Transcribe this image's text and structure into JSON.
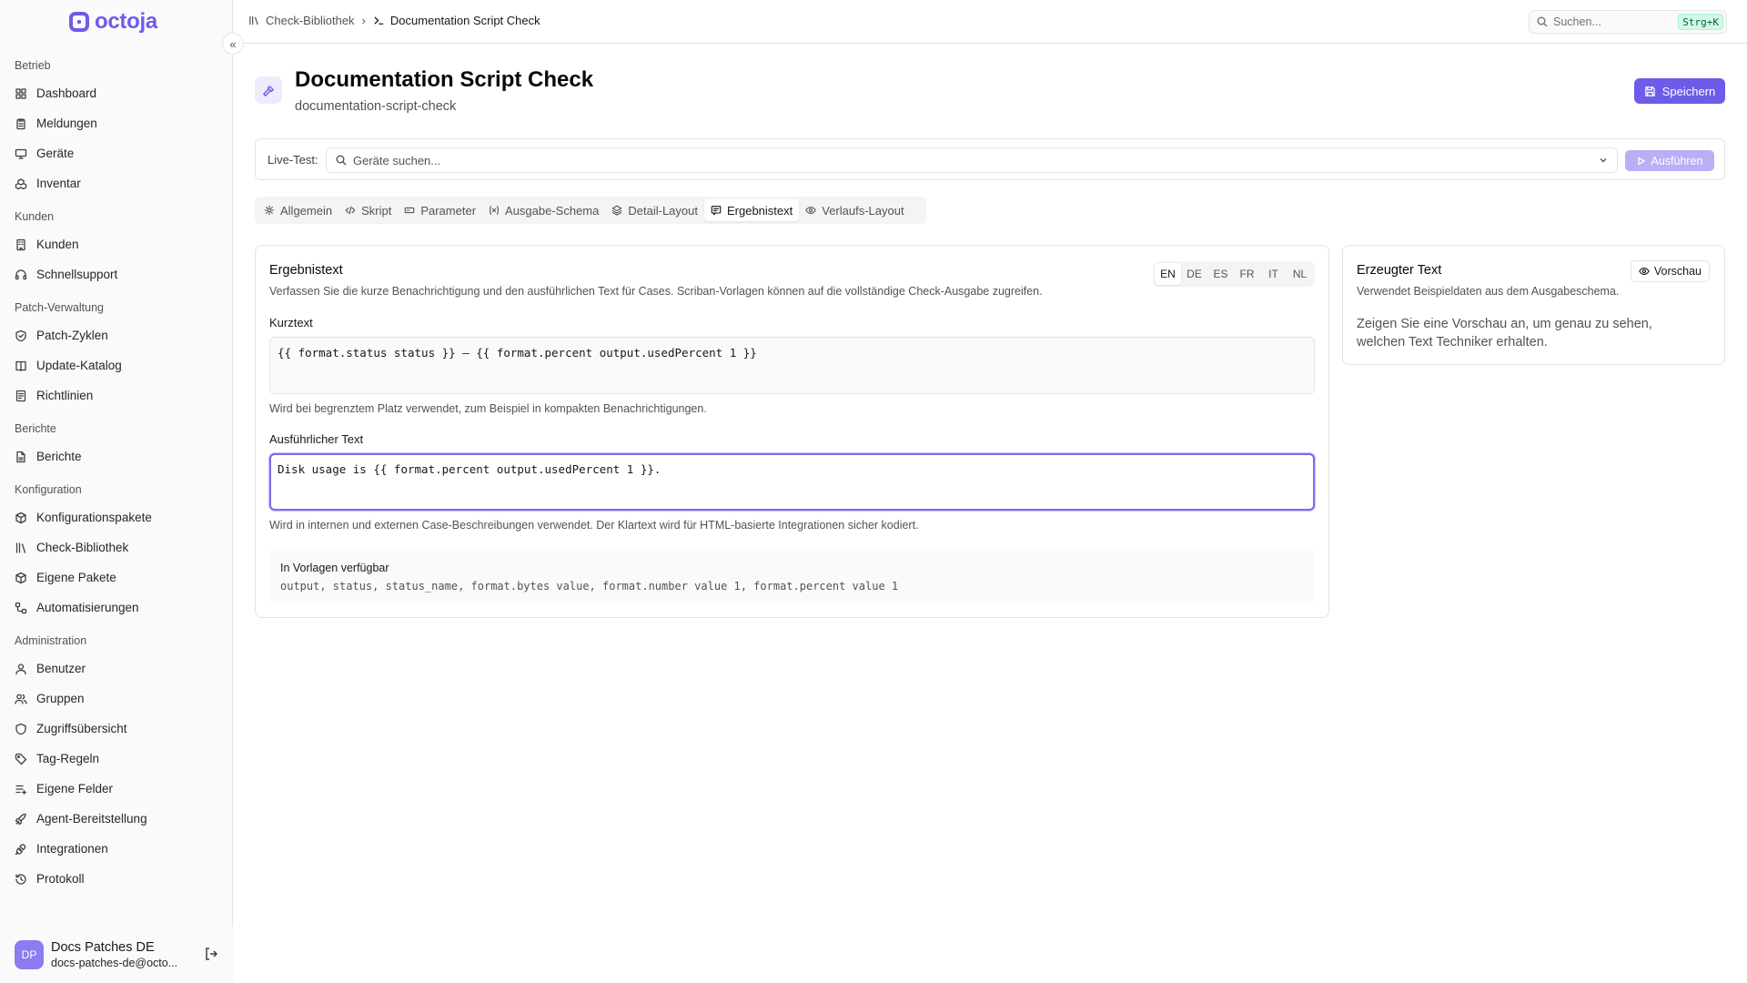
{
  "app": {
    "logo_text": "octoja",
    "brand_color": "#6d5ce8"
  },
  "sidebar": {
    "groups": [
      {
        "label": "Betrieb",
        "items": [
          {
            "label": "Dashboard",
            "icon": "grid-icon"
          },
          {
            "label": "Meldungen",
            "icon": "clipboard-icon"
          },
          {
            "label": "Geräte",
            "icon": "monitor-icon"
          },
          {
            "label": "Inventar",
            "icon": "boxes-icon"
          }
        ]
      },
      {
        "label": "Kunden",
        "items": [
          {
            "label": "Kunden",
            "icon": "building-icon"
          },
          {
            "label": "Schnellsupport",
            "icon": "headset-icon"
          }
        ]
      },
      {
        "label": "Patch-Verwaltung",
        "items": [
          {
            "label": "Patch-Zyklen",
            "icon": "shield-check-icon"
          },
          {
            "label": "Update-Katalog",
            "icon": "book-icon"
          },
          {
            "label": "Richtlinien",
            "icon": "policy-icon"
          }
        ]
      },
      {
        "label": "Berichte",
        "items": [
          {
            "label": "Berichte",
            "icon": "file-icon"
          }
        ]
      },
      {
        "label": "Konfiguration",
        "items": [
          {
            "label": "Konfigurationspakete",
            "icon": "package-icon"
          },
          {
            "label": "Check-Bibliothek",
            "icon": "library-icon"
          },
          {
            "label": "Eigene Pakete",
            "icon": "package-icon"
          },
          {
            "label": "Automatisierungen",
            "icon": "workflow-icon"
          }
        ]
      },
      {
        "label": "Administration",
        "items": [
          {
            "label": "Benutzer",
            "icon": "user-icon"
          },
          {
            "label": "Gruppen",
            "icon": "users-icon"
          },
          {
            "label": "Zugriffsübersicht",
            "icon": "shield-icon"
          },
          {
            "label": "Tag-Regeln",
            "icon": "tag-icon"
          },
          {
            "label": "Eigene Felder",
            "icon": "list-plus-icon"
          },
          {
            "label": "Agent-Bereitstellung",
            "icon": "rocket-icon"
          },
          {
            "label": "Integrationen",
            "icon": "plug-icon"
          },
          {
            "label": "Protokoll",
            "icon": "history-icon"
          }
        ]
      }
    ],
    "user": {
      "initials": "DP",
      "name": "Docs Patches DE",
      "email": "docs-patches-de@octo..."
    }
  },
  "topbar": {
    "breadcrumb": {
      "parent": "Check-Bibliothek",
      "current": "Documentation Script Check"
    },
    "search": {
      "placeholder": "Suchen...",
      "shortcut": "Strg+K"
    }
  },
  "header": {
    "title": "Documentation Script Check",
    "slug": "documentation-script-check",
    "save_label": "Speichern"
  },
  "live_test": {
    "label": "Live-Test:",
    "placeholder": "Geräte suchen...",
    "run_label": "Ausführen"
  },
  "tabs": [
    {
      "label": "Allgemein",
      "icon": "gear-icon",
      "active": false
    },
    {
      "label": "Skript",
      "icon": "code-icon",
      "active": false
    },
    {
      "label": "Parameter",
      "icon": "input-icon",
      "active": false
    },
    {
      "label": "Ausgabe-Schema",
      "icon": "variable-icon",
      "active": false
    },
    {
      "label": "Detail-Layout",
      "icon": "layers-icon",
      "active": false
    },
    {
      "label": "Ergebnistext",
      "icon": "message-icon",
      "active": true
    },
    {
      "label": "Verlaufs-Layout",
      "icon": "eye-icon",
      "active": false
    }
  ],
  "result_text": {
    "title": "Ergebnistext",
    "description": "Verfassen Sie die kurze Benachrichtigung und den ausführlichen Text für Cases. Scriban-Vorlagen können auf die vollständige Check-Ausgabe zugreifen.",
    "languages": [
      "EN",
      "DE",
      "ES",
      "FR",
      "IT",
      "NL"
    ],
    "active_language": "EN",
    "short": {
      "label": "Kurztext",
      "value": "{{ format.status status }} — {{ format.percent output.usedPercent 1 }}",
      "hint": "Wird bei begrenztem Platz verwendet, zum Beispiel in kompakten Benachrichtigungen."
    },
    "long": {
      "label": "Ausführlicher Text",
      "value": "Disk usage is {{ format.percent output.usedPercent 1 }}.",
      "hint": "Wird in internen und externen Case-Beschreibungen verwendet. Der Klartext wird für HTML-basierte Integrationen sicher kodiert."
    },
    "available": {
      "title": "In Vorlagen verfügbar",
      "vars": "output, status, status_name, format.bytes value, format.number value 1, format.percent value 1"
    }
  },
  "generated": {
    "title": "Erzeugter Text",
    "description": "Verwendet Beispieldaten aus dem Ausgabeschema.",
    "preview_label": "Vorschau",
    "empty_text": "Zeigen Sie eine Vorschau an, um genau zu sehen, welchen Text Techniker erhalten."
  }
}
